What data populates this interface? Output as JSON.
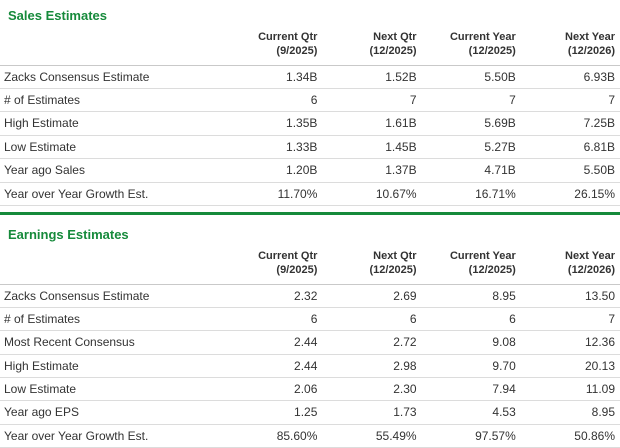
{
  "page": {
    "accent_color": "#168a3b",
    "text_color": "#333333"
  },
  "sales": {
    "title": "Sales Estimates",
    "columns": [
      {
        "line1": "Current Qtr",
        "line2": "(9/2025)"
      },
      {
        "line1": "Next Qtr",
        "line2": "(12/2025)"
      },
      {
        "line1": "Current Year",
        "line2": "(12/2025)"
      },
      {
        "line1": "Next Year",
        "line2": "(12/2026)"
      }
    ],
    "rows": [
      {
        "label": "Zacks Consensus Estimate",
        "values": [
          "1.34B",
          "1.52B",
          "5.50B",
          "6.93B"
        ]
      },
      {
        "label": "# of Estimates",
        "values": [
          "6",
          "7",
          "7",
          "7"
        ]
      },
      {
        "label": "High Estimate",
        "values": [
          "1.35B",
          "1.61B",
          "5.69B",
          "7.25B"
        ]
      },
      {
        "label": "Low Estimate",
        "values": [
          "1.33B",
          "1.45B",
          "5.27B",
          "6.81B"
        ]
      },
      {
        "label": "Year ago Sales",
        "values": [
          "1.20B",
          "1.37B",
          "4.71B",
          "5.50B"
        ]
      },
      {
        "label": "Year over Year Growth Est.",
        "values": [
          "11.70%",
          "10.67%",
          "16.71%",
          "26.15%"
        ]
      }
    ]
  },
  "earnings": {
    "title": "Earnings Estimates",
    "columns": [
      {
        "line1": "Current Qtr",
        "line2": "(9/2025)"
      },
      {
        "line1": "Next Qtr",
        "line2": "(12/2025)"
      },
      {
        "line1": "Current Year",
        "line2": "(12/2025)"
      },
      {
        "line1": "Next Year",
        "line2": "(12/2026)"
      }
    ],
    "rows": [
      {
        "label": "Zacks Consensus Estimate",
        "values": [
          "2.32",
          "2.69",
          "8.95",
          "13.50"
        ]
      },
      {
        "label": "# of Estimates",
        "values": [
          "6",
          "6",
          "6",
          "7"
        ]
      },
      {
        "label": "Most Recent Consensus",
        "values": [
          "2.44",
          "2.72",
          "9.08",
          "12.36"
        ]
      },
      {
        "label": "High Estimate",
        "values": [
          "2.44",
          "2.98",
          "9.70",
          "20.13"
        ]
      },
      {
        "label": "Low Estimate",
        "values": [
          "2.06",
          "2.30",
          "7.94",
          "11.09"
        ]
      },
      {
        "label": "Year ago EPS",
        "values": [
          "1.25",
          "1.73",
          "4.53",
          "8.95"
        ]
      },
      {
        "label": "Year over Year Growth Est.",
        "values": [
          "85.60%",
          "55.49%",
          "97.57%",
          "50.86%"
        ]
      }
    ]
  }
}
